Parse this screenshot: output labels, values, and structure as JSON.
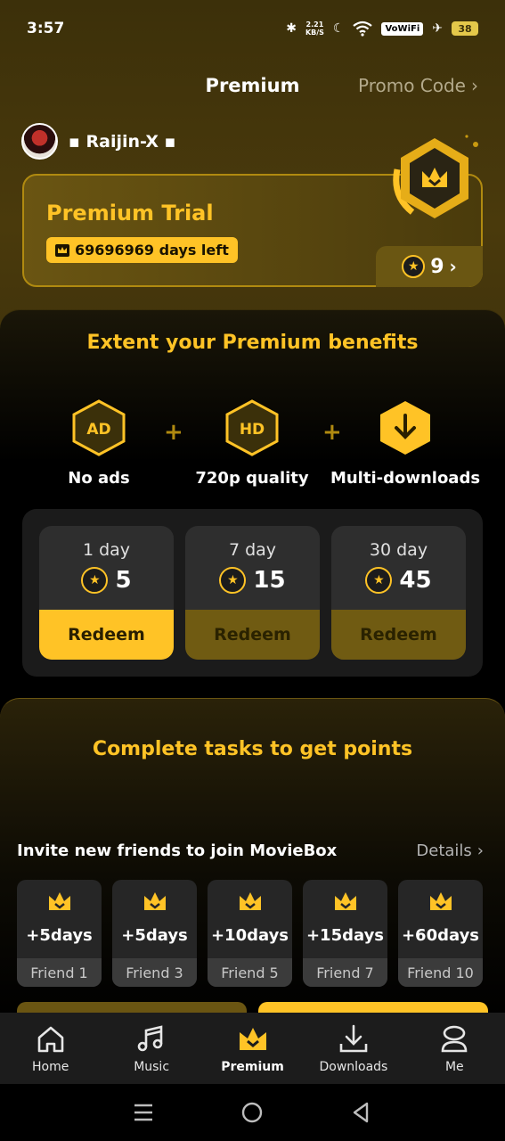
{
  "status_bar": {
    "time": "3:57",
    "net_speed_top": "2.21",
    "net_speed_bottom": "KB/S",
    "vowifi": "VoWiFi",
    "battery": "38"
  },
  "header": {
    "title": "Premium",
    "promo_code": "Promo Code"
  },
  "user": {
    "name": "▪ Raijin-X ▪"
  },
  "trial": {
    "title": "Premium Trial",
    "days_left": "69696969 days left",
    "points": "9"
  },
  "benefits": {
    "title": "Extent your Premium benefits",
    "items": [
      {
        "icon_text": "AD",
        "label": "No ads"
      },
      {
        "icon_text": "HD",
        "label": "720p quality"
      },
      {
        "icon_text": "",
        "label": "Multi-downloads"
      }
    ],
    "plus": "+"
  },
  "plans": [
    {
      "days": "1 day",
      "price": "5",
      "button": "Redeem",
      "active": true
    },
    {
      "days": "7 day",
      "price": "15",
      "button": "Redeem",
      "active": false
    },
    {
      "days": "30 day",
      "price": "45",
      "button": "Redeem",
      "active": false
    }
  ],
  "tasks": {
    "title": "Complete tasks to get points",
    "invite_title": "Invite new friends to join MovieBox",
    "details": "Details",
    "friends": [
      {
        "bonus": "+5days",
        "label": "Friend 1"
      },
      {
        "bonus": "+5days",
        "label": "Friend 3"
      },
      {
        "bonus": "+10days",
        "label": "Friend 5"
      },
      {
        "bonus": "+15days",
        "label": "Friend 7"
      },
      {
        "bonus": "+60days",
        "label": "Friend 10"
      }
    ]
  },
  "bottom_nav": {
    "items": [
      {
        "label": "Home",
        "icon": "home-icon"
      },
      {
        "label": "Music",
        "icon": "music-icon"
      },
      {
        "label": "Premium",
        "icon": "crown-icon"
      },
      {
        "label": "Downloads",
        "icon": "download-icon"
      },
      {
        "label": "Me",
        "icon": "profile-icon"
      }
    ],
    "active": "Premium"
  },
  "colors": {
    "accent": "#ffc326",
    "accent_dark": "#705b12",
    "panel": "#1b1b1b"
  }
}
